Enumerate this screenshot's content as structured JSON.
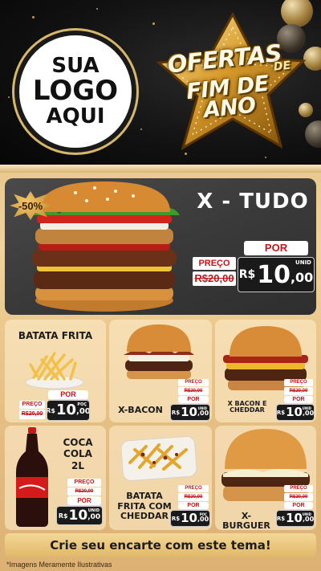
{
  "header": {
    "logo_placeholder": [
      "SUA",
      "LOGO",
      "AQUI"
    ],
    "title_line1": "OFERTAS",
    "title_connector": "DE",
    "title_line2": "FIM DE ANO"
  },
  "featured": {
    "name": "X - TUDO",
    "discount_badge": "-50%",
    "price_label": "PREÇO",
    "old_price": "R$20,00",
    "por_label": "POR",
    "currency": "R$",
    "price_int": "10",
    "price_dec": ",00",
    "unit": "UNID"
  },
  "items": [
    {
      "name": "BATATA FRITA",
      "price_label": "PREÇO",
      "old_price": "R$20,00",
      "por_label": "POR",
      "currency": "R$",
      "price_int": "10",
      "price_dec": ",00",
      "unit": "POÇ"
    },
    {
      "name": "X-BACON",
      "price_label": "PREÇO",
      "old_price": "R$20,00",
      "por_label": "POR",
      "currency": "R$",
      "price_int": "10",
      "price_dec": ",00",
      "unit": "UNID"
    },
    {
      "name": "X BACON E CHEDDAR",
      "price_label": "PREÇO",
      "old_price": "R$20,00",
      "por_label": "POR",
      "currency": "R$",
      "price_int": "10",
      "price_dec": ",00",
      "unit": "UNID"
    },
    {
      "name": "COCA COLA 2L",
      "price_label": "PREÇO",
      "old_price": "R$20,00",
      "por_label": "POR",
      "currency": "R$",
      "price_int": "10",
      "price_dec": ",00",
      "unit": "UNID"
    },
    {
      "name": "BATATA FRITA COM CHEDDAR",
      "price_label": "PREÇO",
      "old_price": "R$20,00",
      "por_label": "POR",
      "currency": "R$",
      "price_int": "10",
      "price_dec": ",00",
      "unit": "POÇ"
    },
    {
      "name": "X-BURGUER",
      "price_label": "PREÇO",
      "old_price": "R$20,00",
      "por_label": "POR",
      "currency": "R$",
      "price_int": "10",
      "price_dec": ",00",
      "unit": "UNID"
    }
  ],
  "item_name_lines": {
    "coca": [
      "COCA",
      "COLA",
      "2L"
    ],
    "batata_cheddar": [
      "BATATA",
      "FRITA COM",
      "CHEDDAR"
    ],
    "bacon_cheddar": [
      "X BACON E",
      "CHEDDAR"
    ]
  },
  "footer": {
    "cta": "Crie seu encarte com este tema!",
    "disclaimer": "*Imagens Meramente Ilustrativas"
  },
  "colors": {
    "accent_gold": "#d7b76a",
    "price_red": "#c1151a",
    "price_box": "#1a1a1a",
    "card_dark": "#3a3a3a"
  }
}
